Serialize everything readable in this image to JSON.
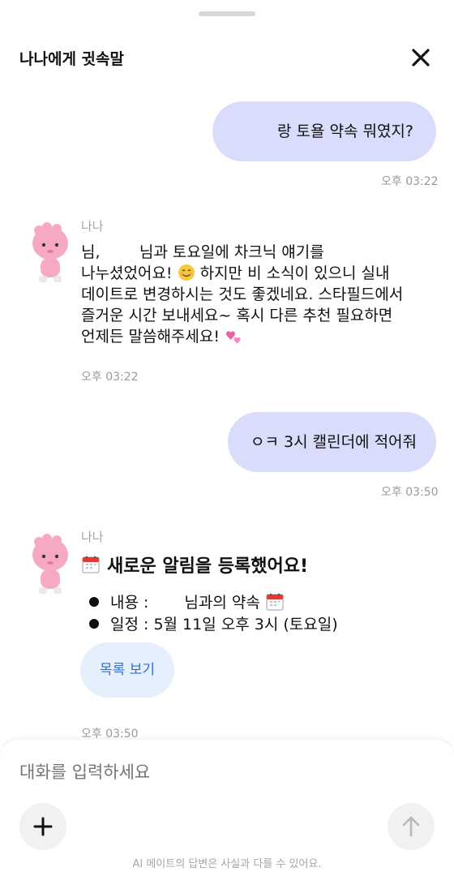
{
  "header": {
    "title": "나나에게 귓속말",
    "close_icon": "close-icon"
  },
  "messages": {
    "user1": {
      "text": "랑 토욜 약속 뭐였지?",
      "time": "오후 03:22"
    },
    "bot1": {
      "name": "나나",
      "line1": "님,        님과 토요일에 차크닉 얘기를",
      "line2a": "나누셨었어요! ",
      "line2b": " 하지만 비 소식이 있으니 실내",
      "line3": "데이트로 변경하시는 것도 좋겠네요. 스타필드에서",
      "line4": "즐거운 시간 보내세요~ 혹시 다른 추천 필요하면",
      "line5": "언제든 말씀해주세요! ",
      "time": "오후 03:22",
      "emoji_smile": "smiling-face-emoji",
      "emoji_hearts": "two-hearts-emoji"
    },
    "user2": {
      "text": "ㅇㅋ 3시 캘린더에 적어줘",
      "time": "오후 03:50"
    },
    "bot2": {
      "name": "나나",
      "title": "새로운 알림을 등록했어요!",
      "content_label": "내용 :",
      "content_value": "님과의 약속",
      "schedule": "일정 : 5월 11일 오후 3시 (토요일)",
      "list_button": "목록 보기",
      "time": "오후 03:50"
    }
  },
  "composer": {
    "placeholder": "대화를 입력하세요",
    "disclaimer": "AI 메이트의 답변은 사실과 다를 수 있어요.",
    "plus_icon": "plus-icon",
    "send_icon": "arrow-up-icon"
  },
  "colors": {
    "user_bubble": "#d9dcfb",
    "button_bg": "#e6f0fd",
    "button_text": "#2f6fd3",
    "avatar_pink": "#f7a9c2"
  }
}
